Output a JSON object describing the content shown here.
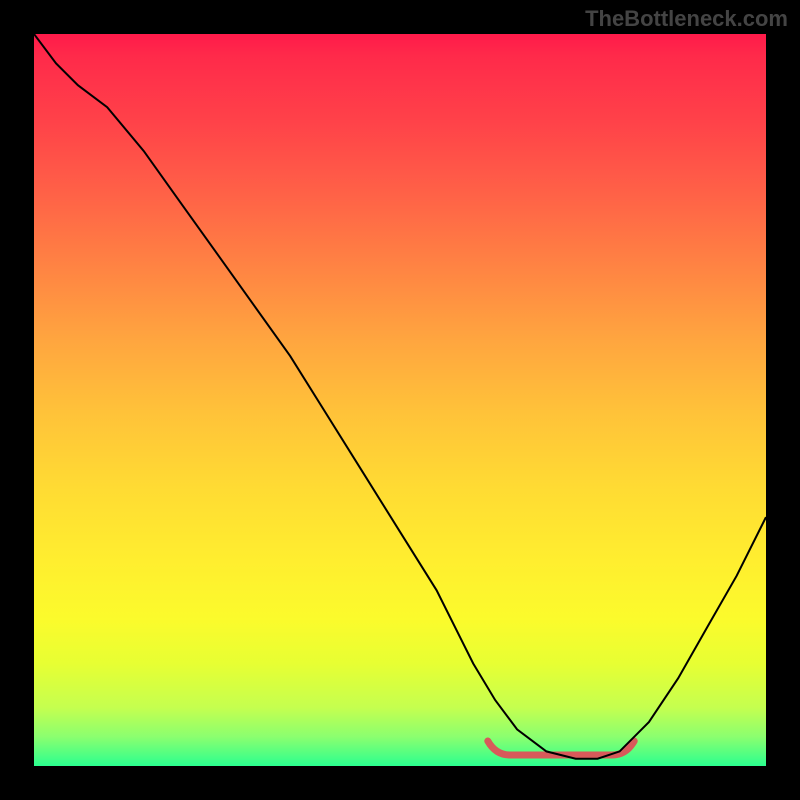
{
  "watermark": "TheBottleneck.com",
  "chart_data": {
    "type": "line",
    "title": "",
    "xlabel": "",
    "ylabel": "",
    "xlim": [
      0,
      100
    ],
    "ylim": [
      0,
      100
    ],
    "grid": false,
    "legend": false,
    "series": [
      {
        "name": "bottleneck-curve",
        "x": [
          0,
          3,
          6,
          10,
          15,
          20,
          25,
          30,
          35,
          40,
          45,
          50,
          55,
          60,
          63,
          66,
          70,
          74,
          77,
          80,
          84,
          88,
          92,
          96,
          100
        ],
        "values": [
          100,
          96,
          93,
          90,
          84,
          77,
          70,
          63,
          56,
          48,
          40,
          32,
          24,
          14,
          9,
          5,
          2,
          1,
          1,
          2,
          6,
          12,
          19,
          26,
          34
        ],
        "color": "#000000"
      }
    ],
    "highlight_band": {
      "name": "optimal-range",
      "x_start": 62,
      "x_end": 82,
      "y": 1.5,
      "color": "#d85a5a"
    },
    "background_gradient": {
      "stops": [
        {
          "pos": 0.0,
          "color": "#ff1a4a"
        },
        {
          "pos": 0.5,
          "color": "#ffc339"
        },
        {
          "pos": 0.85,
          "color": "#e7ff33"
        },
        {
          "pos": 1.0,
          "color": "#2bff8f"
        }
      ],
      "direction": "top-to-bottom"
    }
  }
}
